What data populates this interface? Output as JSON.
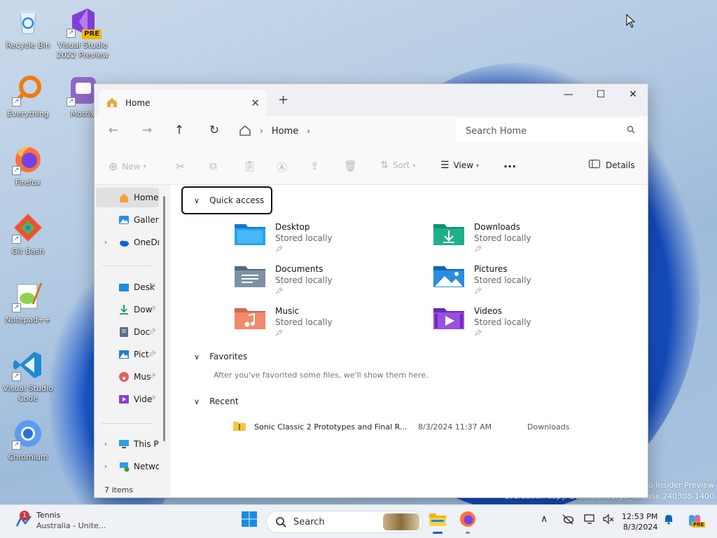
{
  "desktop": {
    "icons": [
      {
        "label": "Recycle Bin"
      },
      {
        "label": "Visual Studio 2022 Preview",
        "badge": "PRE"
      },
      {
        "label": "Everything"
      },
      {
        "label": "Motrix"
      },
      {
        "label": "Firefox"
      },
      {
        "label": "Git Bash"
      },
      {
        "label": "Notepad++"
      },
      {
        "label": "Visual Studio Code"
      },
      {
        "label": "Chromium"
      }
    ],
    "watermark": {
      "line1": "o Insider Preview",
      "line2": "Evaluation copy. Build 26080.ge_release.240308-1400"
    }
  },
  "explorer": {
    "tab_title": "Home",
    "address": {
      "segment": "Home"
    },
    "search_placeholder": "Search Home",
    "toolbar": {
      "new": "New",
      "sort": "Sort",
      "view": "View",
      "more": "···",
      "details": "Details"
    },
    "sidebar": {
      "items": [
        {
          "label": "Home"
        },
        {
          "label": "Gallery"
        },
        {
          "label": "OneDri"
        },
        {
          "label": "Desk"
        },
        {
          "label": "Dow"
        },
        {
          "label": "Doc"
        },
        {
          "label": "Pict"
        },
        {
          "label": "Mus"
        },
        {
          "label": "Vide"
        },
        {
          "label": "This PC"
        },
        {
          "label": "Networ"
        }
      ]
    },
    "status": "7 items",
    "quick_access": {
      "title": "Quick access",
      "folders": [
        {
          "name": "Desktop",
          "sub": "Stored locally"
        },
        {
          "name": "Downloads",
          "sub": "Stored locally"
        },
        {
          "name": "Documents",
          "sub": "Stored locally"
        },
        {
          "name": "Pictures",
          "sub": "Stored locally"
        },
        {
          "name": "Music",
          "sub": "Stored locally"
        },
        {
          "name": "Videos",
          "sub": "Stored locally"
        }
      ]
    },
    "favorites": {
      "title": "Favorites",
      "empty": "After you've favorited some files, we'll show them here."
    },
    "recent": {
      "title": "Recent",
      "items": [
        {
          "name": "Sonic Classic 2 Prototypes and Final R...",
          "date": "8/3/2024 11:37 AM",
          "location": "Downloads"
        }
      ]
    }
  },
  "taskbar": {
    "weather": {
      "title": "Tennis",
      "sub": "Australia - Unite...",
      "badge": "1"
    },
    "search_placeholder": "Search",
    "time": "12:53 PM",
    "date": "8/3/2024",
    "copilot_badge": "PRE"
  },
  "colors": {
    "accent": "#0067c0",
    "folder_yellow": "#f4c542",
    "desktop_folder": "#1a8ce0"
  }
}
